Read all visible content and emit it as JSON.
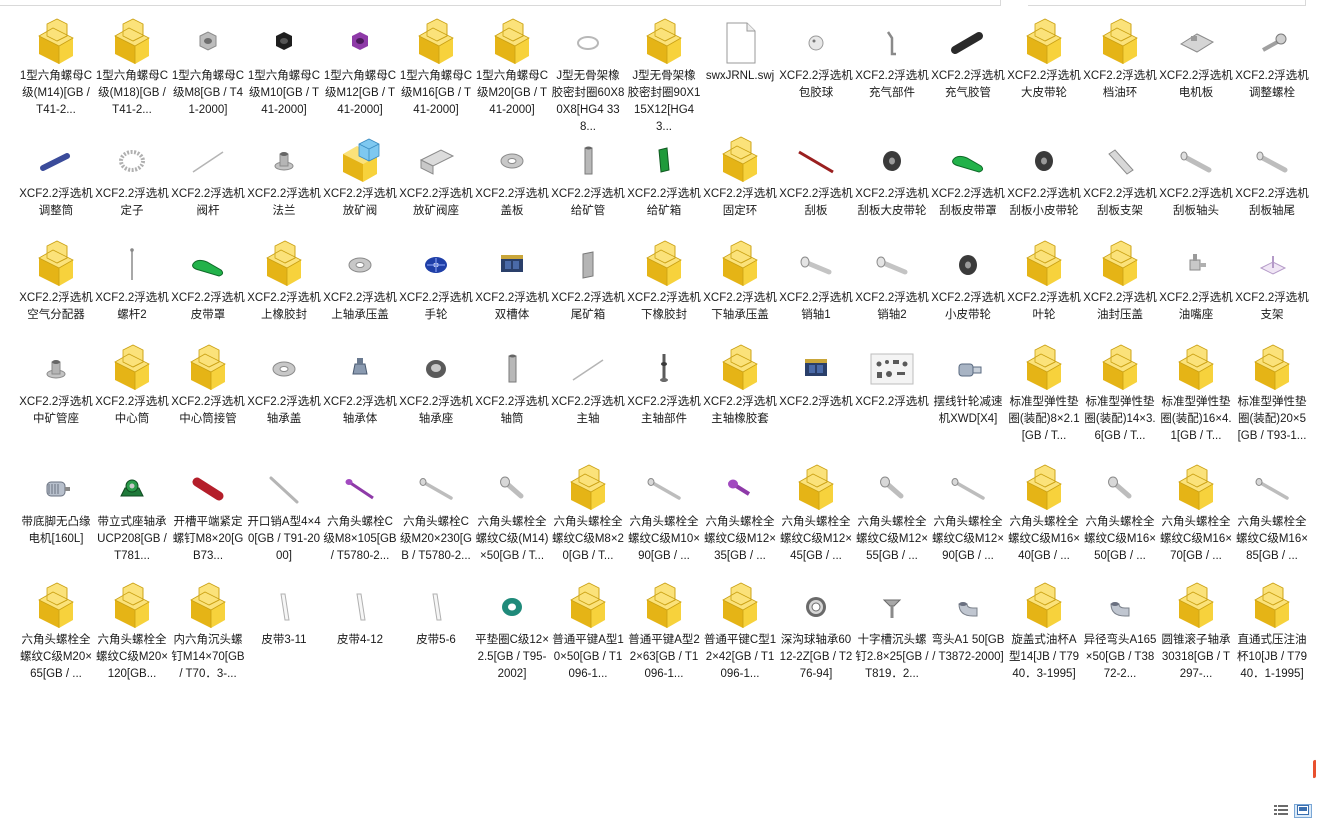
{
  "colors": {
    "folder_front": "#f7d23c",
    "folder_back": "#e5b416",
    "folder_edge": "#caa012",
    "label_text": "#1a1a1a",
    "selection_blue": "#dbeaf8"
  },
  "view": {
    "details_icon": "details-view-icon",
    "large_icons_icon": "large-icons-view-icon"
  },
  "files": [
    {
      "label": "1型六角螺母C级(M14)[GB / T41-2...",
      "icon": "folder-part"
    },
    {
      "label": "1型六角螺母C级(M18)[GB / T41-2...",
      "icon": "folder-part"
    },
    {
      "label": "1型六角螺母C级M8[GB / T41-2000]",
      "icon": "hexnut-silver"
    },
    {
      "label": "1型六角螺母C级M10[GB / T41-2000]",
      "icon": "hexnut-black"
    },
    {
      "label": "1型六角螺母C级M12[GB / T41-2000]",
      "icon": "hexnut-purple"
    },
    {
      "label": "1型六角螺母C级M16[GB / T41-2000]",
      "icon": "folder-part"
    },
    {
      "label": "1型六角螺母C级M20[GB / T41-2000]",
      "icon": "folder-part"
    },
    {
      "label": "J型无骨架橡胶密封圈60X80X8[HG4 338...",
      "icon": "ring-thin"
    },
    {
      "label": "J型无骨架橡胶密封圈90X115X12[HG4 3...",
      "icon": "folder-part"
    },
    {
      "label": "swxJRNL.swj",
      "icon": "blank-file"
    },
    {
      "label": "XCF2.2浮选机 包胶球",
      "icon": "ball"
    },
    {
      "label": "XCF2.2浮选机 充气部件",
      "icon": "crank"
    },
    {
      "label": "XCF2.2浮选机 充气胶管",
      "icon": "tube-black"
    },
    {
      "label": "XCF2.2浮选机 大皮带轮",
      "icon": "folder-part"
    },
    {
      "label": "XCF2.2浮选机 档油环",
      "icon": "folder-part"
    },
    {
      "label": "XCF2.2浮选机 电机板",
      "icon": "plate-bracket"
    },
    {
      "label": "XCF2.2浮选机 调整螺栓",
      "icon": "bolt-head"
    },
    {
      "label": "XCF2.2浮选机 调整筒",
      "icon": "tube-blue"
    },
    {
      "label": "XCF2.2浮选机 定子",
      "icon": "stator"
    },
    {
      "label": "XCF2.2浮选机 阀杆",
      "icon": "rod-thin"
    },
    {
      "label": "XCF2.2浮选机 法兰",
      "icon": "flange-small"
    },
    {
      "label": "XCF2.2浮选机 放矿阀",
      "icon": "folder-part-blue"
    },
    {
      "label": "XCF2.2浮选机 放矿阀座",
      "icon": "channel"
    },
    {
      "label": "XCF2.2浮选机 盖板",
      "icon": "washer-silver"
    },
    {
      "label": "XCF2.2浮选机 给矿管",
      "icon": "pipe-vertical"
    },
    {
      "label": "XCF2.2浮选机 给矿箱",
      "icon": "box-green"
    },
    {
      "label": "XCF2.2浮选机 固定环",
      "icon": "folder-part"
    },
    {
      "label": "XCF2.2浮选机 刮板",
      "icon": "rod-red"
    },
    {
      "label": "XCF2.2浮选机 刮板大皮带轮",
      "icon": "pulley-dark"
    },
    {
      "label": "XCF2.2浮选机 刮板皮带罩",
      "icon": "guard-green"
    },
    {
      "label": "XCF2.2浮选机 刮板小皮带轮",
      "icon": "pulley-dark"
    },
    {
      "label": "XCF2.2浮选机 刮板支架",
      "icon": "bracket-silver"
    },
    {
      "label": "XCF2.2浮选机 刮板轴头",
      "icon": "shaft-silver"
    },
    {
      "label": "XCF2.2浮选机 刮板轴尾",
      "icon": "shaft-silver"
    },
    {
      "label": "XCF2.2浮选机 空气分配器",
      "icon": "folder-part"
    },
    {
      "label": "XCF2.2浮选机 螺杆2",
      "icon": "screw-thin"
    },
    {
      "label": "XCF2.2浮选机 皮带罩",
      "icon": "guard-green"
    },
    {
      "label": "XCF2.2浮选机 上橡胶封",
      "icon": "folder-part"
    },
    {
      "label": "XCF2.2浮选机 上轴承压盖",
      "icon": "washer-silver"
    },
    {
      "label": "XCF2.2浮选机 手轮",
      "icon": "handwheel"
    },
    {
      "label": "XCF2.2浮选机 双槽体",
      "icon": "machine"
    },
    {
      "label": "XCF2.2浮选机 尾矿箱",
      "icon": "plate-gray"
    },
    {
      "label": "XCF2.2浮选机 下橡胶封",
      "icon": "folder-part"
    },
    {
      "label": "XCF2.2浮选机 下轴承压盖",
      "icon": "folder-part"
    },
    {
      "label": "XCF2.2浮选机 销轴1",
      "icon": "pin-silver"
    },
    {
      "label": "XCF2.2浮选机 销轴2",
      "icon": "pin-silver"
    },
    {
      "label": "XCF2.2浮选机 小皮带轮",
      "icon": "pulley-dark"
    },
    {
      "label": "XCF2.2浮选机 叶轮",
      "icon": "folder-part"
    },
    {
      "label": "XCF2.2浮选机 油封压盖",
      "icon": "folder-part"
    },
    {
      "label": "XCF2.2浮选机 油嘴座",
      "icon": "nozzle"
    },
    {
      "label": "XCF2.2浮选机 支架",
      "icon": "bracket-pink"
    },
    {
      "label": "XCF2.2浮选机 中矿管座",
      "icon": "flange-small"
    },
    {
      "label": "XCF2.2浮选机 中心筒",
      "icon": "folder-part"
    },
    {
      "label": "XCF2.2浮选机 中心筒接管",
      "icon": "folder-part"
    },
    {
      "label": "XCF2.2浮选机 轴承盖",
      "icon": "washer-silver"
    },
    {
      "label": "XCF2.2浮选机 轴承体",
      "icon": "bearing-housing"
    },
    {
      "label": "XCF2.2浮选机 轴承座",
      "icon": "ring-dark"
    },
    {
      "label": "XCF2.2浮选机 轴筒",
      "icon": "pipe-vertical"
    },
    {
      "label": "XCF2.2浮选机 主轴",
      "icon": "rod-thin"
    },
    {
      "label": "XCF2.2浮选机 主轴部件",
      "icon": "spindle"
    },
    {
      "label": "XCF2.2浮选机 主轴橡胶套",
      "icon": "folder-part"
    },
    {
      "label": "XCF2.2浮选机",
      "icon": "machine"
    },
    {
      "label": "XCF2.2浮选机",
      "icon": "assembly-sheet"
    },
    {
      "label": "摆线针轮减速机XWD[X4]",
      "icon": "reducer"
    },
    {
      "label": "标准型弹性垫圈(装配)8×2.1[GB / T...",
      "icon": "folder-part"
    },
    {
      "label": "标准型弹性垫圈(装配)14×3.6[GB / T...",
      "icon": "folder-part"
    },
    {
      "label": "标准型弹性垫圈(装配)16×4.1[GB / T...",
      "icon": "folder-part"
    },
    {
      "label": "标准型弹性垫圈(装配)20×5[GB / T93-1...",
      "icon": "folder-part"
    },
    {
      "label": "带底脚无凸缘电机[160L]",
      "icon": "motor"
    },
    {
      "label": "带立式座轴承UCP208[GB / T781...",
      "icon": "pillow-block"
    },
    {
      "label": "开槽平端紧定螺钉M8×20[GB73...",
      "icon": "rod-red-thick"
    },
    {
      "label": "开口销A型4×40[GB / T91-2000]",
      "icon": "pin-long"
    },
    {
      "label": "六角头螺栓C级M8×105[GB / T5780-2...",
      "icon": "bolt-purple"
    },
    {
      "label": "六角头螺栓C级M20×230[GB / T5780-2...",
      "icon": "bolt-long"
    },
    {
      "label": "六角头螺栓全螺纹C级(M14)×50[GB / T...",
      "icon": "bolt-short"
    },
    {
      "label": "六角头螺栓全螺纹C级M8×20[GB / T...",
      "icon": "folder-part"
    },
    {
      "label": "六角头螺栓全螺纹C级M10×90[GB / ...",
      "icon": "bolt-long"
    },
    {
      "label": "六角头螺栓全螺纹C级M12×35[GB / ...",
      "icon": "bolt-purple-short"
    },
    {
      "label": "六角头螺栓全螺纹C级M12×45[GB / ...",
      "icon": "folder-part"
    },
    {
      "label": "六角头螺栓全螺纹C级M12×55[GB / ...",
      "icon": "bolt-short"
    },
    {
      "label": "六角头螺栓全螺纹C级M12×90[GB / ...",
      "icon": "bolt-long"
    },
    {
      "label": "六角头螺栓全螺纹C级M16×40[GB / ...",
      "icon": "folder-part"
    },
    {
      "label": "六角头螺栓全螺纹C级M16×50[GB / ...",
      "icon": "bolt-short"
    },
    {
      "label": "六角头螺栓全螺纹C级M16×70[GB / ...",
      "icon": "folder-part"
    },
    {
      "label": "六角头螺栓全螺纹C级M16×85[GB / ...",
      "icon": "bolt-long"
    },
    {
      "label": "六角头螺栓全螺纹C级M20×65[GB / ...",
      "icon": "folder-part"
    },
    {
      "label": "六角头螺栓全螺纹C级M20×120[GB...",
      "icon": "folder-part"
    },
    {
      "label": "内六角沉头螺钉M14×70[GB / T70．3-...",
      "icon": "folder-part"
    },
    {
      "label": "皮带3-11",
      "icon": "belt"
    },
    {
      "label": "皮带4-12",
      "icon": "belt"
    },
    {
      "label": "皮带5-6",
      "icon": "belt"
    },
    {
      "label": "平垫圈C级12×2.5[GB / T95-2002]",
      "icon": "washer-green"
    },
    {
      "label": "普通平键A型10×50[GB / T1096-1...",
      "icon": "folder-part"
    },
    {
      "label": "普通平键A型22×63[GB / T1096-1...",
      "icon": "folder-part"
    },
    {
      "label": "普通平键C型12×42[GB / T1096-1...",
      "icon": "folder-part"
    },
    {
      "label": "深沟球轴承6012-2Z[GB / T276-94]",
      "icon": "ball-bearing"
    },
    {
      "label": "十字槽沉头螺钉2.8×25[GB / T819．2...",
      "icon": "screw-countersunk"
    },
    {
      "label": "弯头A1 50[GB / T3872-2000]",
      "icon": "elbow"
    },
    {
      "label": "旋盖式油杯A型14[JB / T7940．3-1995]",
      "icon": "folder-part"
    },
    {
      "label": "异径弯头A165×50[GB / T3872-2...",
      "icon": "elbow"
    },
    {
      "label": "圆锥滚子轴承30318[GB / T297-...",
      "icon": "folder-part"
    },
    {
      "label": "直通式压注油杯10[JB / T7940．1-1995]",
      "icon": "folder-part"
    }
  ]
}
